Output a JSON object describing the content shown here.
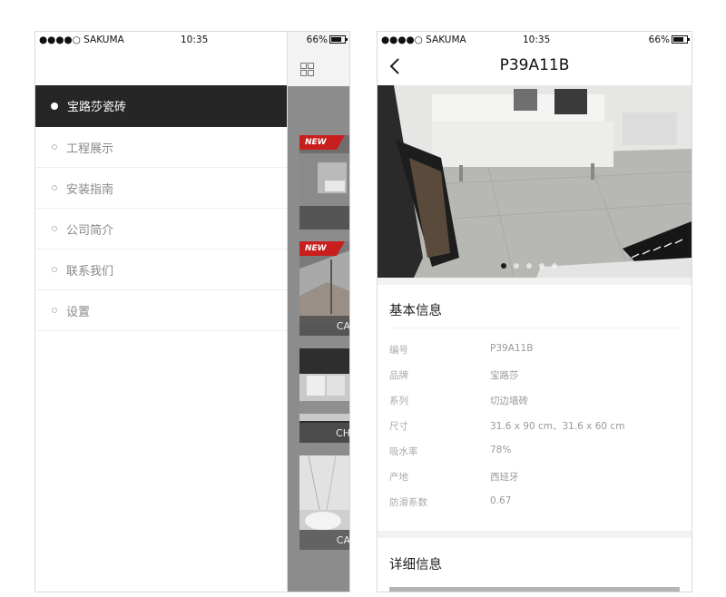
{
  "left_screen": {
    "status": {
      "carrier": "●●●●○ SAKUMA",
      "time": "10:35",
      "battery": "66%"
    },
    "menu": [
      {
        "label": "宝路莎瓷砖",
        "active": true
      },
      {
        "label": "工程展示"
      },
      {
        "label": "安装指南"
      },
      {
        "label": "公司简介"
      },
      {
        "label": "联系我们"
      },
      {
        "label": "设置"
      }
    ],
    "thumbnails": [
      {
        "badge": "NEW",
        "caption": ""
      },
      {
        "badge": "NEW",
        "caption": "CA"
      },
      {
        "badge": "",
        "caption": "CH"
      },
      {
        "badge": "",
        "caption": "CA"
      }
    ]
  },
  "right_screen": {
    "status": {
      "carrier": "●●●●○ SAKUMA",
      "time": "10:35",
      "battery": "66%"
    },
    "title": "P39A11B",
    "carousel": {
      "count": 5,
      "active_index": 0
    },
    "basic_info": {
      "title": "基本信息",
      "rows": [
        {
          "label": "编号",
          "value": "P39A11B"
        },
        {
          "label": "品牌",
          "value": "宝路莎"
        },
        {
          "label": "系列",
          "value": "切边墙砖"
        },
        {
          "label": "尺寸",
          "value": "31.6 x 90 cm、31.6 x 60 cm"
        },
        {
          "label": "吸水率",
          "value": "78%"
        },
        {
          "label": "产地",
          "value": "西班牙"
        },
        {
          "label": "防滑系数",
          "value": "0.67"
        }
      ]
    },
    "detail_info": {
      "title": "详细信息"
    }
  }
}
